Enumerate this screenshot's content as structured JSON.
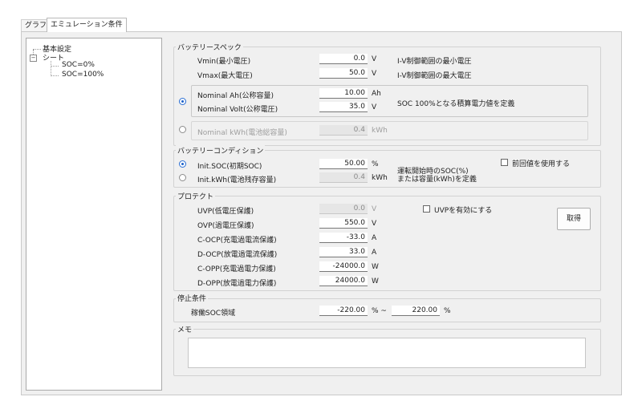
{
  "tabs": {
    "graph": "グラフ",
    "emulation": "エミュレーション条件"
  },
  "tree": {
    "basic": "基本設定",
    "sheet": "シート",
    "soc0": "SOC=0%",
    "soc100": "SOC=100%"
  },
  "spec": {
    "title": "バッテリースペック",
    "vmin": {
      "label": "Vmin(最小電圧)",
      "value": "0.0",
      "unit": "V",
      "desc": "I-V制御範囲の最小電圧"
    },
    "vmax": {
      "label": "Vmax(最大電圧)",
      "value": "50.0",
      "unit": "V",
      "desc": "I-V制御範囲の最大電圧"
    },
    "nom_ah": {
      "label": "Nominal Ah(公称容量)",
      "value": "10.00",
      "unit": "Ah"
    },
    "nom_volt": {
      "label": "Nominal Volt(公称電圧)",
      "value": "35.0",
      "unit": "V"
    },
    "nominal_desc": "SOC 100%となる積算電力値を定義",
    "nom_kwh": {
      "label": "Nominal kWh(電池総容量)",
      "value": "0.4",
      "unit": "kWh"
    }
  },
  "condition": {
    "title": "バッテリーコンディション",
    "init_soc": {
      "label": "Init.SOC(初期SOC)",
      "value": "50.00",
      "unit": "%"
    },
    "init_kwh": {
      "label": "Init.kWh(電池残存容量)",
      "value": "0.4",
      "unit": "kWh"
    },
    "desc_line1": "運転開始時のSOC(%)",
    "desc_line2": "または容量(kWh)を定義",
    "prev_label": "前回値を使用する"
  },
  "protect": {
    "title": "プロテクト",
    "uvp": {
      "label": "UVP(低電圧保護)",
      "value": "0.0",
      "unit": "V"
    },
    "ovp": {
      "label": "OVP(過電圧保護)",
      "value": "550.0",
      "unit": "V"
    },
    "cocp": {
      "label": "C-OCP(充電過電流保護)",
      "value": "-33.0",
      "unit": "A"
    },
    "docp": {
      "label": "D-OCP(放電過電流保護)",
      "value": "33.0",
      "unit": "A"
    },
    "copp": {
      "label": "C-OPP(充電過電力保護)",
      "value": "-24000.0",
      "unit": "W"
    },
    "dopp": {
      "label": "D-OPP(放電過電力保護)",
      "value": "24000.0",
      "unit": "W"
    },
    "uvp_enable": "UVPを有効にする",
    "get_button": "取得"
  },
  "stop": {
    "title": "停止条件",
    "range_label": "稼働SOC領域",
    "low": "-220.00",
    "low_unit": "% ~",
    "high": "220.00",
    "high_unit": "%"
  },
  "memo": {
    "title": "メモ",
    "text": ""
  }
}
